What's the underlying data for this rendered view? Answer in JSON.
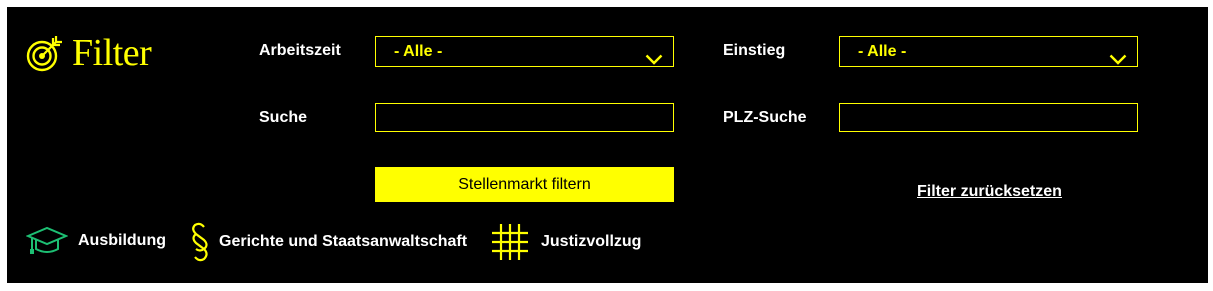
{
  "filter": {
    "title": "Filter",
    "accent_color": "#ffff00",
    "fields": {
      "arbeitszeit": {
        "label": "Arbeitszeit",
        "value": "- Alle -"
      },
      "einstieg": {
        "label": "Einstieg",
        "value": "- Alle -"
      },
      "suche": {
        "label": "Suche",
        "value": ""
      },
      "plz_suche": {
        "label": "PLZ-Suche",
        "value": ""
      }
    },
    "submit_label": "Stellenmarkt filtern",
    "reset_label": "Filter zurücksetzen"
  },
  "categories": [
    {
      "label": "Ausbildung",
      "icon": "graduation-cap-icon",
      "color": "#1dbf73"
    },
    {
      "label": "Gerichte und Staatsanwaltschaft",
      "icon": "paragraph-icon",
      "color": "#ffff00"
    },
    {
      "label": "Justizvollzug",
      "icon": "grid-bars-icon",
      "color": "#ffff00"
    }
  ]
}
